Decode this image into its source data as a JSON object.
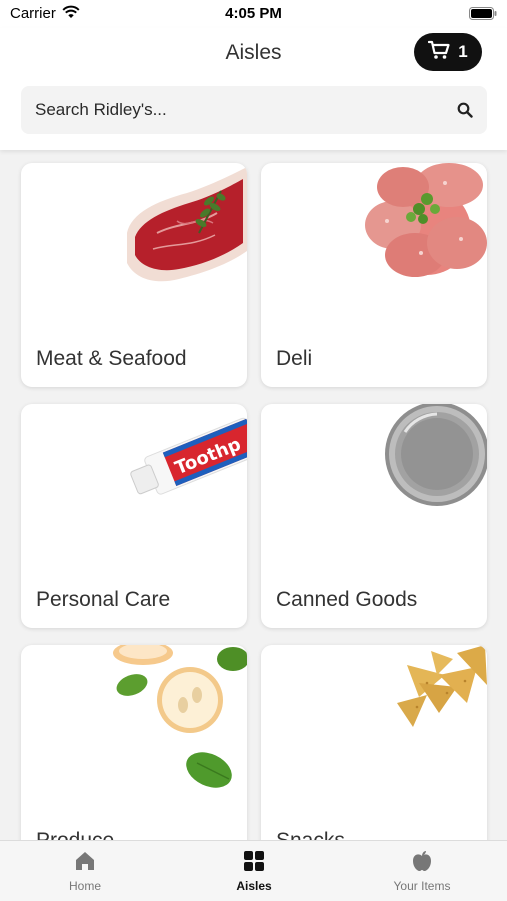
{
  "status_bar": {
    "carrier": "Carrier",
    "time": "4:05 PM"
  },
  "header": {
    "title": "Aisles",
    "cart_count": "1",
    "search_placeholder": "Search Ridley's..."
  },
  "aisles": [
    {
      "label": "Meat & Seafood",
      "image": "steak-image"
    },
    {
      "label": "Deli",
      "image": "salami-image"
    },
    {
      "label": "Personal Care",
      "image": "toothpaste-image",
      "image_text": "Toothp"
    },
    {
      "label": "Canned Goods",
      "image": "can-image"
    },
    {
      "label": "Produce",
      "image": "apple-image"
    },
    {
      "label": "Snacks",
      "image": "chips-image"
    }
  ],
  "tabs": [
    {
      "label": "Home",
      "icon": "home-icon",
      "active": false
    },
    {
      "label": "Aisles",
      "icon": "grid-icon",
      "active": true
    },
    {
      "label": "Your Items",
      "icon": "apple-icon",
      "active": false
    }
  ],
  "colors": {
    "cart_bg": "#111111",
    "card_bg": "#ffffff",
    "background": "#f2f2f2"
  }
}
